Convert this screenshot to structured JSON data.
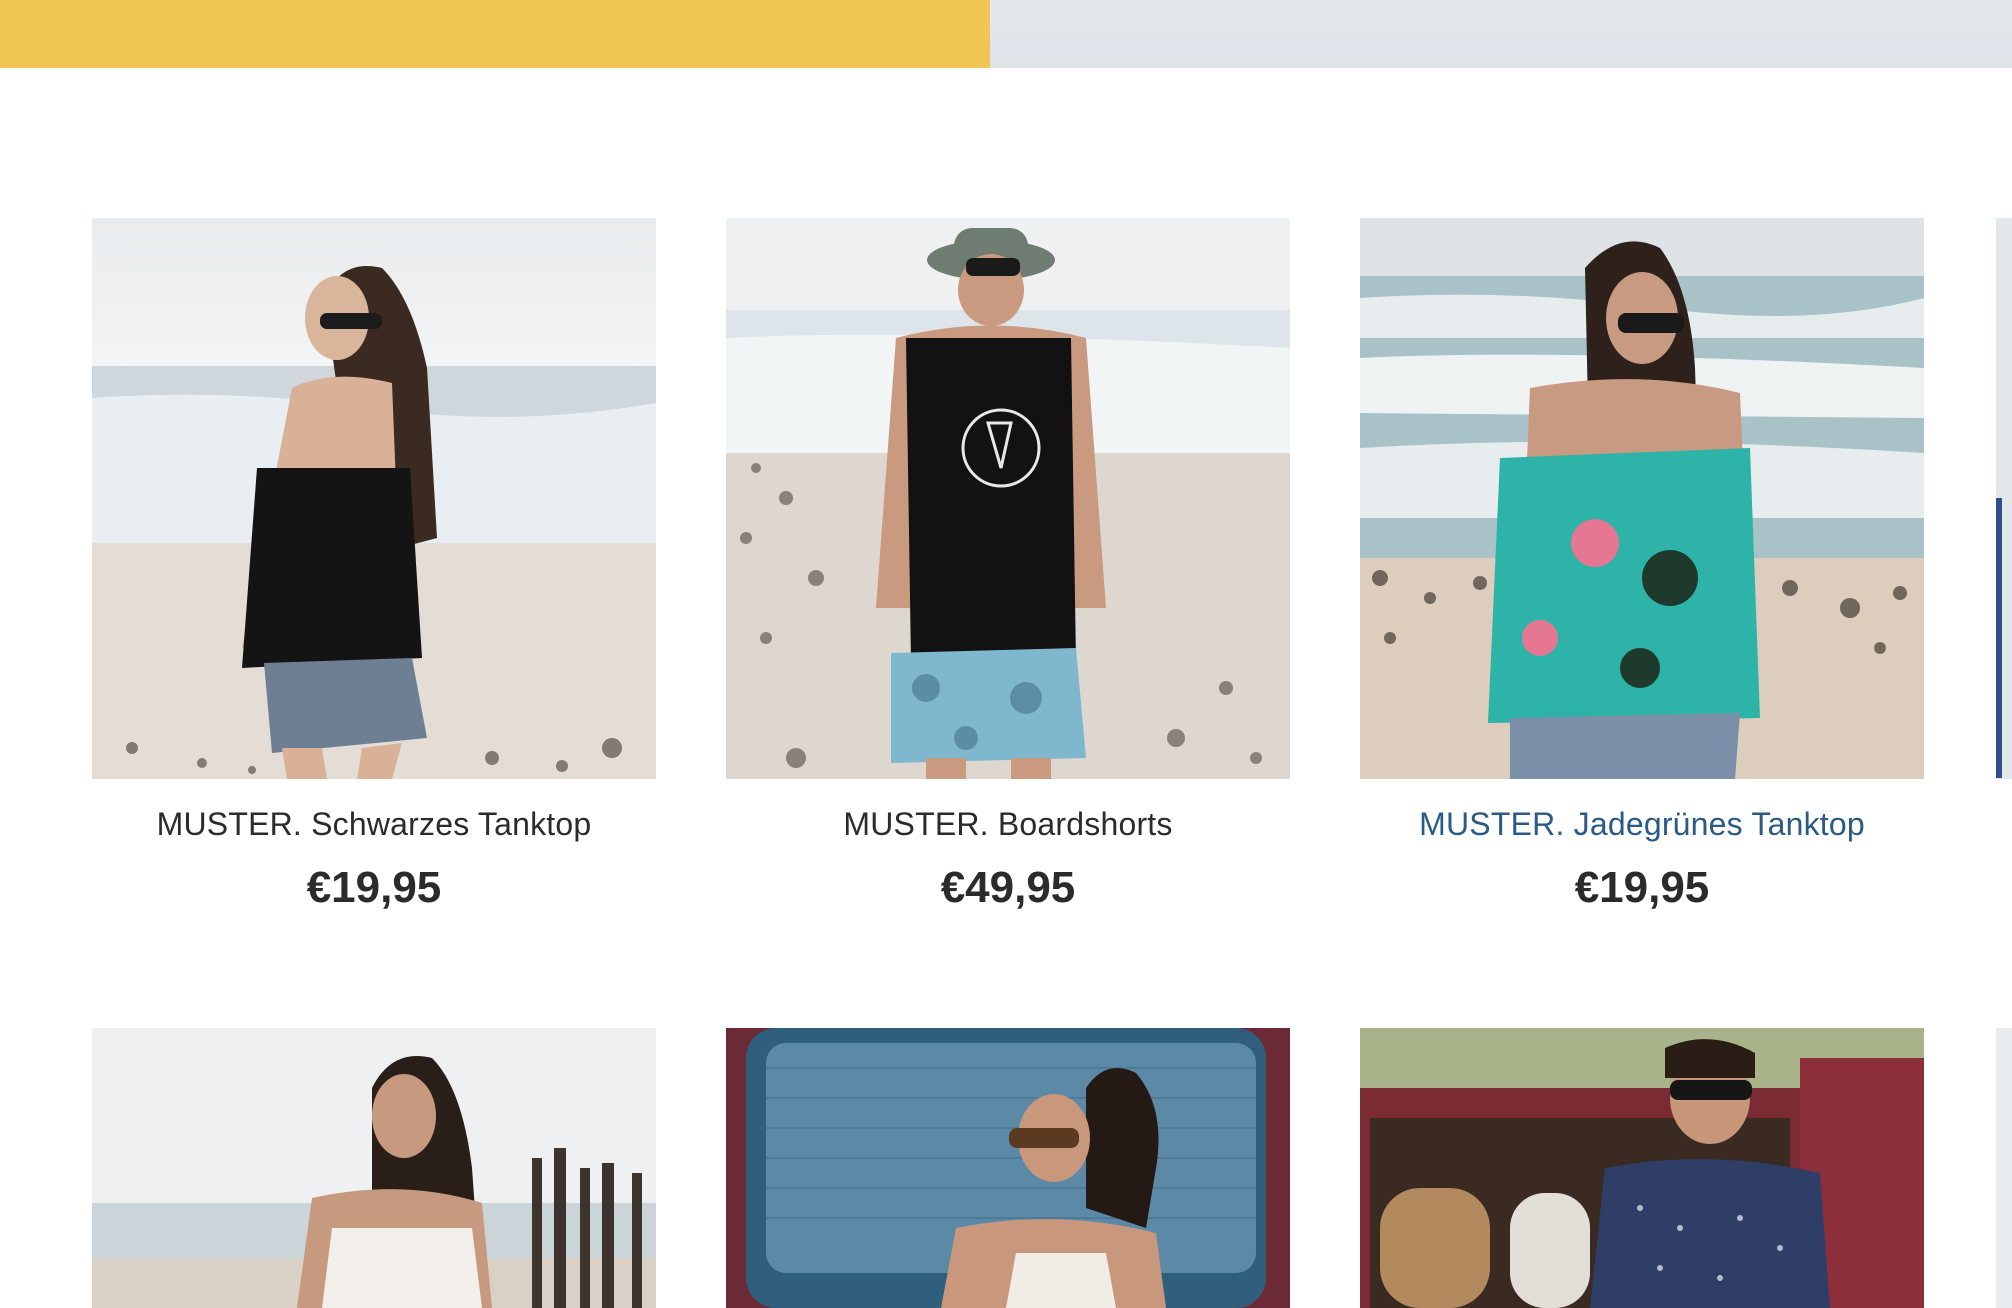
{
  "colors": {
    "banner_left": "#f1c552",
    "banner_right": "#e1e7eb",
    "link_hover": "#2c5a86",
    "text": "#2b2b2b"
  },
  "products_row1": [
    {
      "title": "MUSTER. Schwarzes Tanktop",
      "price": "€19,95",
      "image": "woman-black-tanktop-beach"
    },
    {
      "title": "MUSTER. Boardshorts",
      "price": "€49,95",
      "image": "man-bucket-hat-boardshorts-beach"
    },
    {
      "title": "MUSTER. Jadegrünes Tanktop",
      "price": "€19,95",
      "image": "woman-jade-floral-tanktop-beach"
    }
  ],
  "products_row2": [
    {
      "image": "woman-white-lace-top-beach-fence"
    },
    {
      "image": "woman-sunglasses-blue-van"
    },
    {
      "image": "man-patterned-shirt-red-van"
    }
  ]
}
